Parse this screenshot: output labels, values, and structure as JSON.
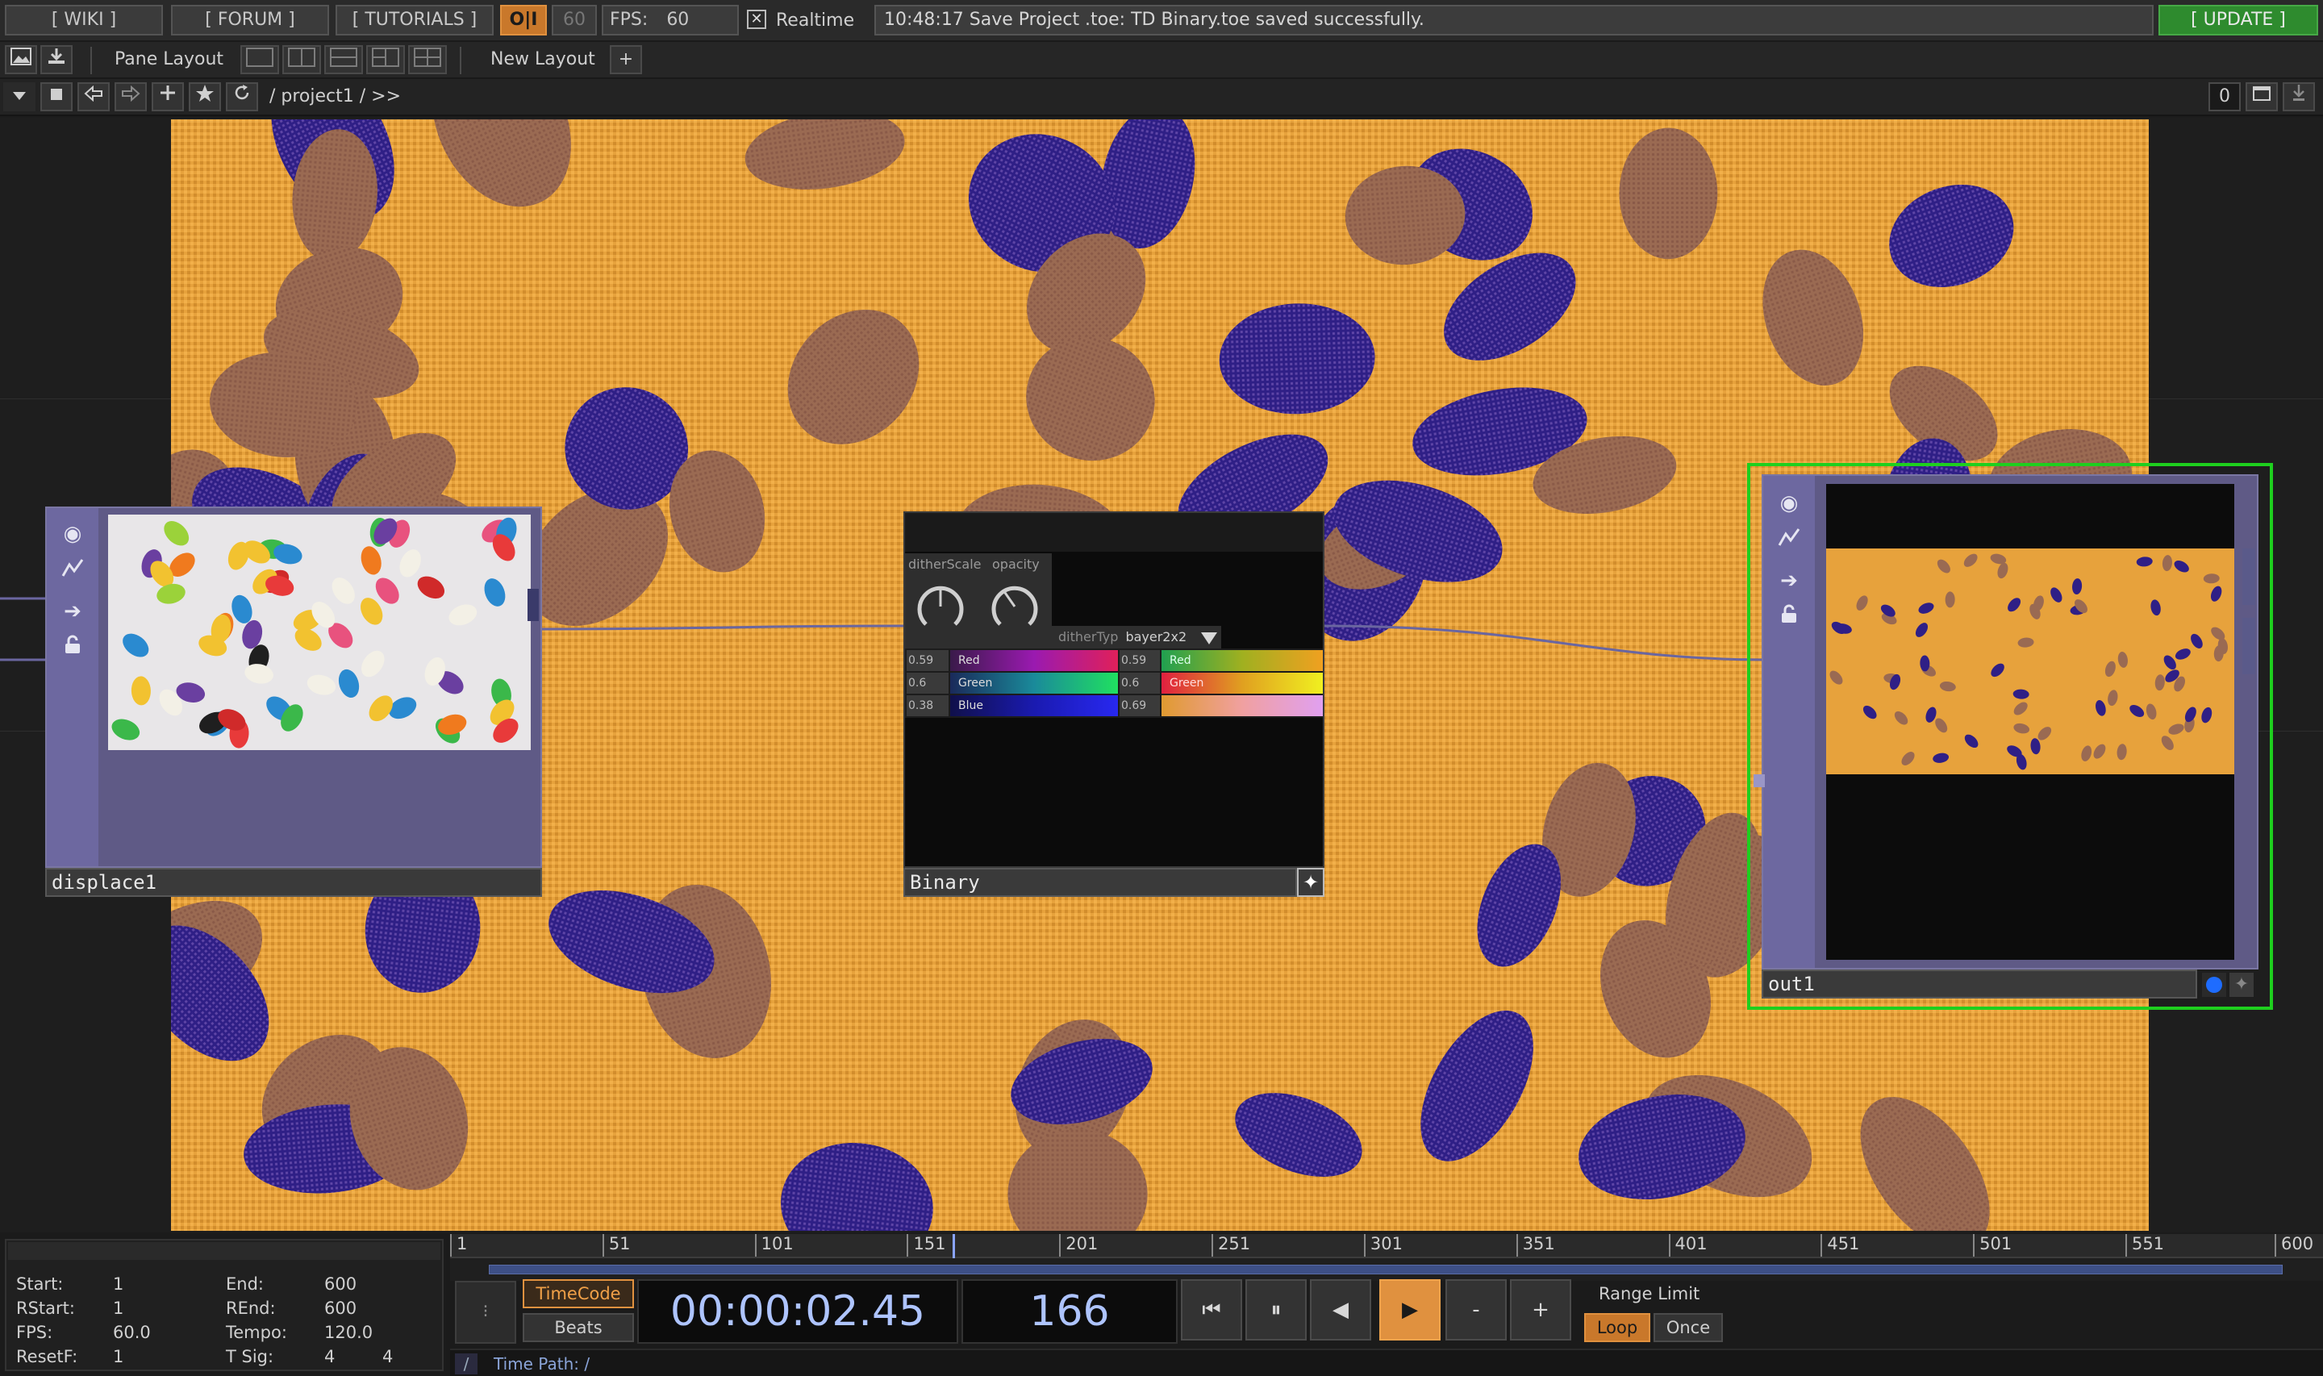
{
  "topbar": {
    "wiki": "[ WIKI ]",
    "forum": "[ FORUM ]",
    "tutorials": "[ TUTORIALS ]",
    "oi": "O|I",
    "fps_cap": "60",
    "fps_label": "FPS:",
    "fps_value": "60",
    "realtime_label": "Realtime",
    "realtime_mark": "✕",
    "status_message": "10:48:17 Save Project .toe: TD Binary.toe saved successfully.",
    "update": "[ UPDATE ]"
  },
  "layoutbar": {
    "pane_layout": "Pane Layout",
    "new_layout": "New Layout",
    "add": "+"
  },
  "pathbar": {
    "path": "/ project1 / >>",
    "counter": "0"
  },
  "nodes": {
    "displace": {
      "name": "displace1"
    },
    "binary": {
      "name": "Binary",
      "knob1_label": "ditherScale",
      "knob2_label": "opacity",
      "dither_type_label": "ditherTyp",
      "dither_type_value": "bayer2x2",
      "sliders_left": [
        {
          "value": "0.59",
          "label": "Red"
        },
        {
          "value": "0.6",
          "label": "Green"
        },
        {
          "value": "0.38",
          "label": "Blue"
        }
      ],
      "sliders_right": [
        {
          "value": "0.59",
          "label": "Red"
        },
        {
          "value": "0.6",
          "label": "Green"
        },
        {
          "value": "0.69",
          "label": ""
        }
      ]
    },
    "out": {
      "name": "out1"
    }
  },
  "timeline": {
    "ruler": [
      "1",
      "51",
      "101",
      "151",
      "201",
      "251",
      "301",
      "351",
      "401",
      "451",
      "501",
      "551",
      "600"
    ],
    "playhead_frame": 166,
    "start_label": "Start:",
    "start": "1",
    "end_label": "End:",
    "end": "600",
    "rstart_label": "RStart:",
    "rstart": "1",
    "rend_label": "REnd:",
    "rend": "600",
    "fps_label": "FPS:",
    "fps": "60.0",
    "tempo_label": "Tempo:",
    "tempo": "120.0",
    "resetf_label": "ResetF:",
    "resetf": "1",
    "tsig_label": "T Sig:",
    "tsig_a": "4",
    "tsig_b": "4",
    "timecode_btn": "TimeCode",
    "beats_btn": "Beats",
    "timecode": "00:00:02.45",
    "frame": "166",
    "range_limit": "Range Limit",
    "loop": "Loop",
    "once": "Once",
    "minus": "-",
    "plus": "+",
    "time_path_prefix": "/",
    "time_path": "Time Path: /"
  },
  "colors": {
    "accent_orange": "#e0913f",
    "grid_orange": "#e7a23c",
    "bean_purple": "#2f1f86",
    "bean_brown": "#9a6a52",
    "selection_green": "#1ecf1e",
    "update_green": "#2e8b2e"
  }
}
